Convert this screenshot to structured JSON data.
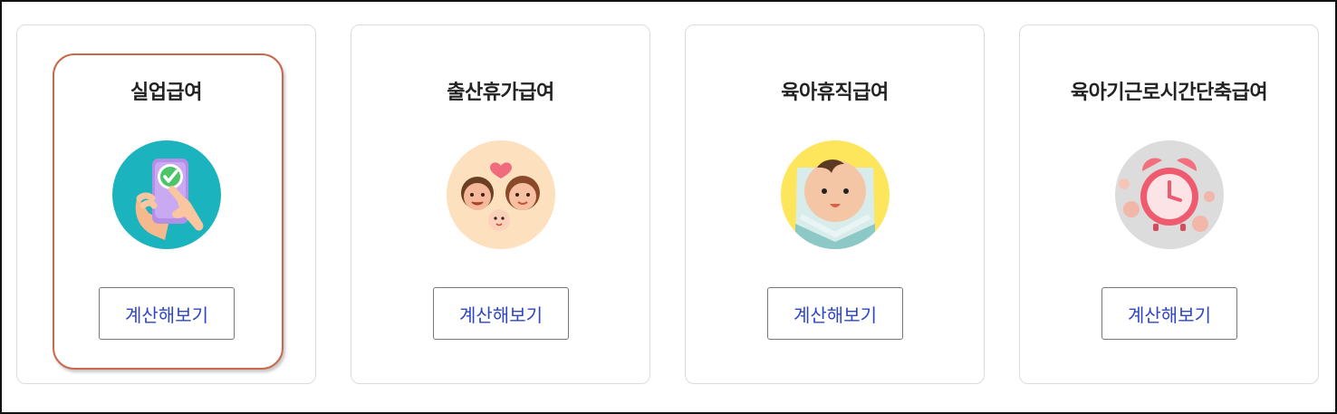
{
  "cards": [
    {
      "title": "실업급여",
      "button": "계산해보기",
      "icon": "phone-check-hands-icon",
      "bg": "#1bb3bd",
      "selected": true
    },
    {
      "title": "출산휴가급여",
      "button": "계산해보기",
      "icon": "family-faces-heart-icon",
      "bg": "#fde0bd",
      "selected": false
    },
    {
      "title": "육아휴직급여",
      "button": "계산해보기",
      "icon": "baby-face-icon",
      "bg": "#fde65c",
      "selected": false
    },
    {
      "title": "육아기근로시간단축급여",
      "button": "계산해보기",
      "icon": "alarm-clock-coins-icon",
      "bg": "#dcdcdc",
      "selected": false
    }
  ],
  "colors": {
    "selected_border": "#c8694d",
    "button_text": "#2f46c4",
    "card_border": "#dcdcdc"
  }
}
